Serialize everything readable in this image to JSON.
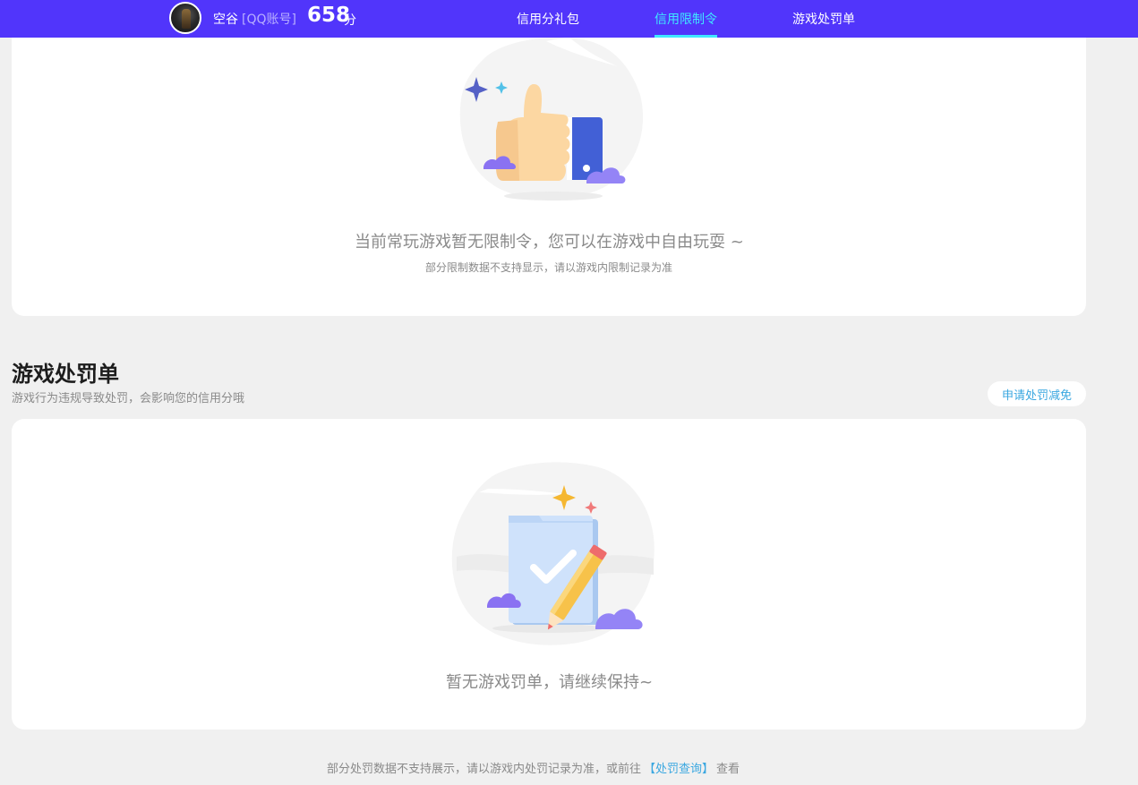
{
  "header": {
    "username": "空谷",
    "account_type": "[QQ账号]",
    "score": "658",
    "score_unit": "分",
    "tabs": [
      {
        "label": "信用分礼包",
        "active": false
      },
      {
        "label": "信用限制令",
        "active": true
      },
      {
        "label": "游戏处罚单",
        "active": false
      }
    ]
  },
  "restriction": {
    "empty_title": "当前常玩游戏暂无限制令，您可以在游戏中自由玩耍 ~",
    "empty_subtitle": "部分限制数据不支持显示，请以游戏内限制记录为准"
  },
  "penalty": {
    "title": "游戏处罚单",
    "subtitle": "游戏行为违规导致处罚，会影响您的信用分哦",
    "appeal_button": "申请处罚减免",
    "empty_title": "暂无游戏罚单，请继续保持~"
  },
  "footer": {
    "note_prefix": "部分处罚数据不支持展示，请以游戏内处罚记录为准，或前往",
    "link": "【处罚查询】",
    "note_suffix": "查看"
  },
  "colors": {
    "header_bg": "#5135fb",
    "active_tab": "#3fe8ff",
    "link": "#3aa7e0"
  }
}
